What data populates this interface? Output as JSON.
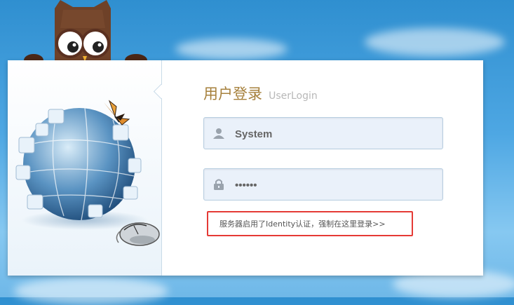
{
  "login": {
    "title_cn": "用户登录",
    "title_en": "UserLogin",
    "username_value": "System",
    "password_value": "••••••",
    "notice_text": "服务器启用了Identity认证，强制在这里登录>>"
  },
  "colors": {
    "title": "#a6803c",
    "notice_border": "#e53a35",
    "field_bg": "#eaf1fa",
    "background": "#4ea7e3"
  },
  "icons": {
    "username": "user-icon",
    "password": "lock-icon",
    "mascot": "owl-icon",
    "illustration": "puzzle-globe-icon",
    "decor": [
      "butterfly-icon",
      "mouse-icon"
    ]
  }
}
